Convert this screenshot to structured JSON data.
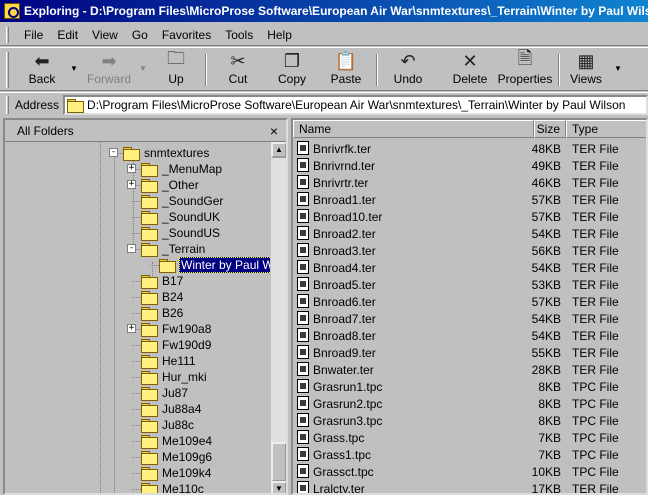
{
  "window": {
    "title": "Exploring - D:\\Program Files\\MicroProse Software\\European Air War\\snmtextures\\_Terrain\\Winter by Paul Wilson"
  },
  "menu": [
    "File",
    "Edit",
    "View",
    "Go",
    "Favorites",
    "Tools",
    "Help"
  ],
  "toolbar": {
    "back": "Back",
    "forward": "Forward",
    "up": "Up",
    "cut": "Cut",
    "copy": "Copy",
    "paste": "Paste",
    "undo": "Undo",
    "delete": "Delete",
    "properties": "Properties",
    "views": "Views"
  },
  "address": {
    "label": "Address",
    "value": "D:\\Program Files\\MicroProse Software\\European Air War\\snmtextures\\_Terrain\\Winter by Paul Wilson"
  },
  "folders_pane": {
    "title": "All Folders",
    "close": "×"
  },
  "tree": [
    {
      "label": "snmtextures",
      "expander": "minus"
    },
    {
      "label": "_MenuMap",
      "expander": "plus"
    },
    {
      "label": "_Other",
      "expander": "plus"
    },
    {
      "label": "_SoundGer",
      "expander": ""
    },
    {
      "label": "_SoundUK",
      "expander": ""
    },
    {
      "label": "_SoundUS",
      "expander": ""
    },
    {
      "label": "_Terrain",
      "expander": "minus"
    },
    {
      "label": "Winter by Paul Wilson",
      "expander": "",
      "selected": true
    },
    {
      "label": "B17",
      "expander": ""
    },
    {
      "label": "B24",
      "expander": ""
    },
    {
      "label": "B26",
      "expander": ""
    },
    {
      "label": "Fw190a8",
      "expander": "plus"
    },
    {
      "label": "Fw190d9",
      "expander": ""
    },
    {
      "label": "He111",
      "expander": ""
    },
    {
      "label": "Hur_mki",
      "expander": ""
    },
    {
      "label": "Ju87",
      "expander": ""
    },
    {
      "label": "Ju88a4",
      "expander": ""
    },
    {
      "label": "Ju88c",
      "expander": ""
    },
    {
      "label": "Me109e4",
      "expander": ""
    },
    {
      "label": "Me109g6",
      "expander": ""
    },
    {
      "label": "Me109k4",
      "expander": ""
    },
    {
      "label": "Me110c",
      "expander": ""
    }
  ],
  "columns": {
    "name": "Name",
    "size": "Size",
    "type": "Type"
  },
  "files": [
    {
      "name": "Bnrivrfk.ter",
      "size": "48KB",
      "type": "TER File"
    },
    {
      "name": "Bnrivrnd.ter",
      "size": "49KB",
      "type": "TER File"
    },
    {
      "name": "Bnrivrtr.ter",
      "size": "46KB",
      "type": "TER File"
    },
    {
      "name": "Bnroad1.ter",
      "size": "57KB",
      "type": "TER File"
    },
    {
      "name": "Bnroad10.ter",
      "size": "57KB",
      "type": "TER File"
    },
    {
      "name": "Bnroad2.ter",
      "size": "54KB",
      "type": "TER File"
    },
    {
      "name": "Bnroad3.ter",
      "size": "56KB",
      "type": "TER File"
    },
    {
      "name": "Bnroad4.ter",
      "size": "54KB",
      "type": "TER File"
    },
    {
      "name": "Bnroad5.ter",
      "size": "53KB",
      "type": "TER File"
    },
    {
      "name": "Bnroad6.ter",
      "size": "57KB",
      "type": "TER File"
    },
    {
      "name": "Bnroad7.ter",
      "size": "54KB",
      "type": "TER File"
    },
    {
      "name": "Bnroad8.ter",
      "size": "54KB",
      "type": "TER File"
    },
    {
      "name": "Bnroad9.ter",
      "size": "55KB",
      "type": "TER File"
    },
    {
      "name": "Bnwater.ter",
      "size": "28KB",
      "type": "TER File"
    },
    {
      "name": "Grasrun1.tpc",
      "size": "8KB",
      "type": "TPC File"
    },
    {
      "name": "Grasrun2.tpc",
      "size": "8KB",
      "type": "TPC File"
    },
    {
      "name": "Grasrun3.tpc",
      "size": "8KB",
      "type": "TPC File"
    },
    {
      "name": "Grass.tpc",
      "size": "7KB",
      "type": "TPC File"
    },
    {
      "name": "Grass1.tpc",
      "size": "7KB",
      "type": "TPC File"
    },
    {
      "name": "Grassct.tpc",
      "size": "10KB",
      "type": "TPC File"
    },
    {
      "name": "Lralcty.ter",
      "size": "17KB",
      "type": "TER File"
    }
  ]
}
